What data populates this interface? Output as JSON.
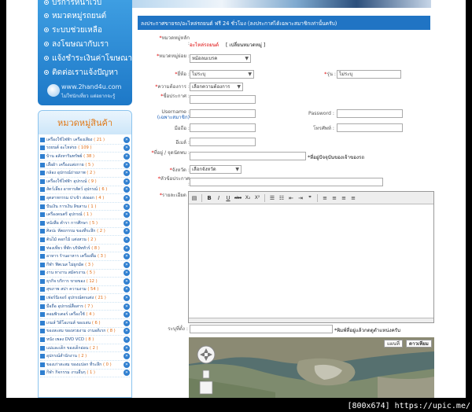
{
  "nav": {
    "items": [
      "บริการหน้าเว็บ",
      "หมวดหมู่รถยนต์",
      "ระบบช่วยเหลือ",
      "ลงโฆษณากับเรา",
      "แจ้งชำระเงินค่าโฆษณา",
      "ติดต่อเราแจ้งปัญหา"
    ],
    "logo_text": "www.2hand4u.com",
    "logo_sub": "ไม่ใช่นักเที่ยว แต่อยากจะรู้"
  },
  "categories": {
    "title": "หมวดหมู่สินค้า",
    "items": [
      {
        "name": "เครื่องใช้ไฟฟ้า เครื่องเสียง",
        "count": "( 21 )"
      },
      {
        "name": "รถยนต์ อะไหล่รถ",
        "count": "( 109 )"
      },
      {
        "name": "บ้าน อสังหาริมทรัพย์",
        "count": "( 38 )"
      },
      {
        "name": "เสื้อผ้า เครื่องแต่งกาย",
        "count": "( 5 )"
      },
      {
        "name": "กล้อง อุปกรณ์ถ่ายภาพ",
        "count": "( 2 )"
      },
      {
        "name": "เครื่องใช้ไฟฟ้า อุปกรณ์",
        "count": "( 9 )"
      },
      {
        "name": "สัตว์เลี้ยง อาหารสัตว์ อุปกรณ์",
        "count": "( 6 )"
      },
      {
        "name": "อุตสาหกรรม ปาเข้า ส่งออก",
        "count": "( 4 )"
      },
      {
        "name": "ปันเงิน การเงิน ลิขสาน",
        "count": "( 1 )"
      },
      {
        "name": "เครื่องดนตรี อุปกรณ์",
        "count": "( 1 )"
      },
      {
        "name": "หนังสือ ตำรา การศึกษา",
        "count": "( 5 )"
      },
      {
        "name": "ศิลปะ หัตถกรรม ของที่ระลึก",
        "count": "( 2 )"
      },
      {
        "name": "ต้นไม้ ดอกไม้ แต่งสวน",
        "count": "( 2 )"
      },
      {
        "name": "ท่องเที่ยว ที่พัก บริษัททัวร์",
        "count": "( 8 )"
      },
      {
        "name": "อาหาร ร้านอาหาร เครื่องดื่ม",
        "count": "( 3 )"
      },
      {
        "name": "กีฬา ฟิตเนส ไม่ผูกมัด",
        "count": "( 3 )"
      },
      {
        "name": "งาน หางาน สมัครงาน",
        "count": "( 5 )"
      },
      {
        "name": "ธุรกิจ บริการ ขายของ",
        "count": "( 12 )"
      },
      {
        "name": "สุขภาพ สปา ความงาม",
        "count": "( 54 )"
      },
      {
        "name": "เฟอร์นิเจอร์ อุปกรณ์ตกแต่ง",
        "count": "( 21 )"
      },
      {
        "name": "มือถือ อุปกรณ์สื่อสาร",
        "count": "( 7 )"
      },
      {
        "name": "คอมพิวเตอร์ เครื่องใช้",
        "count": "( 4 )"
      },
      {
        "name": "เกมส์ วิดีโอเกมส์ ของเล่น",
        "count": "( 6 )"
      },
      {
        "name": "ของสะสม ของสวยงาม งานอดิเรก",
        "count": "( 8 )"
      },
      {
        "name": "หนัง เพลง DVD VCD",
        "count": "( 8 )"
      },
      {
        "name": "แม่และเด็ก ของเด็กอ่อน",
        "count": "( 2 )"
      },
      {
        "name": "อุปกรณ์สำนักงาน",
        "count": "( 2 )"
      },
      {
        "name": "ของเก่าสะสม ของแปลก ที่ระลึก",
        "count": "( 0 )"
      },
      {
        "name": "กีฬา กิจกรรม งานอื่นๆ",
        "count": "( 1 )"
      }
    ]
  },
  "form": {
    "header": "ลงประกาศขายรถ/อะไหล่รถยนต์ ฟรี 24 ชั่วโมง (ลงประกาศได้เฉพาะสมาชิกเท่านั้นครับ)",
    "category_label": "หมวดหมู่หลัก :",
    "category_value": "อะไหล่รถยนต์",
    "category_change": "[ เปลี่ยนหมวดหมู่ ]",
    "subcategory_label": "หมวดหมู่ย่อย :",
    "subcategory_value": "หม้อลมเบรค",
    "brand_label": "ยี่ห้อ :",
    "brand_value": "ไม่ระบุ",
    "model_label": "รุ่น :",
    "model_value": "ไม่ระบุ",
    "need_label": "ความต้องการ :",
    "need_value": "เลือกความต้องการ",
    "title_label": "ชื่อประกาศ :",
    "username_label": "Username :",
    "username_hint": "(เฉพาะสมาชิก)",
    "password_label": "Password :",
    "mobile_label": "มือถือ :",
    "phone_label": "โทรศัพท์ :",
    "email_label": "อีเมล์ :",
    "address_label": "ที่อยู่ / จุดนัดพบ :",
    "address_note": "*ที่อยู่ปัจจุบันของเจ้าของรถ",
    "province_label": "จังหวัด :",
    "province_value": "เลือกจังหวัด",
    "headline_label": "หัวข้อประกาศ :",
    "detail_label": "รายละเอียด :",
    "location_label": "ระบุที่ตั้ง :",
    "location_note": "*พิมพ์ที่อยู่แล้วกดดูตำแหน่งครับ",
    "map_btn_map": "แผนที่",
    "map_btn_sat": "ดาวเทียม"
  },
  "toolbar": {
    "bold": "B",
    "italic": "I",
    "underline": "U",
    "strike": "abc",
    "sub": "X₂",
    "sup": "X²",
    "quote": "❞"
  },
  "caption": "[800x674] https://upic.me/"
}
